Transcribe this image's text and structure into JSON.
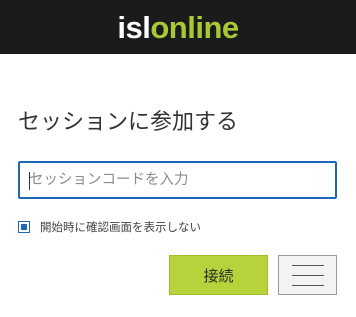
{
  "header": {
    "logo_isl": "isl",
    "logo_online": "online"
  },
  "main": {
    "title": "セッションに参加する",
    "session_code": {
      "value": "",
      "placeholder": "セッションコードを入力"
    },
    "confirm_checkbox": {
      "checked": true,
      "label": "開始時に確認画面を表示しない"
    },
    "connect_label": "接続"
  },
  "icons": {
    "menu": "hamburger-menu-icon",
    "checkbox": "checkbox-checked-icon"
  },
  "colors": {
    "header_bg": "#1b1b1b",
    "brand_green": "#a8c936",
    "button_green": "#b6d33c",
    "accent_blue": "#1f67b5"
  }
}
